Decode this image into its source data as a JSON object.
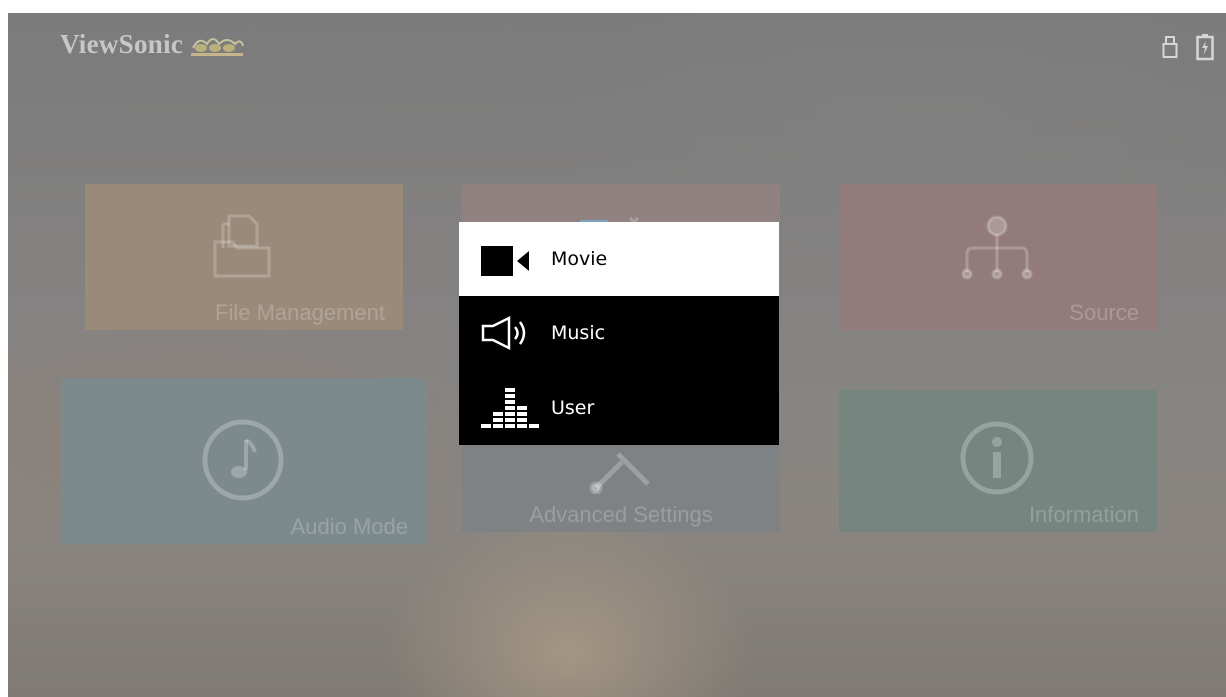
{
  "brand": {
    "name": "ViewSonic"
  },
  "status": {
    "icons": [
      "usb-icon",
      "battery-icon"
    ]
  },
  "tiles": [
    {
      "label": "File Management",
      "icon": "folder-icon"
    },
    {
      "label": "",
      "icon": "display-icon"
    },
    {
      "label": "Source",
      "icon": "source-icon"
    },
    {
      "label": "Audio Mode",
      "icon": "music-note-icon"
    },
    {
      "label": "Advanced Settings",
      "icon": "tools-icon"
    },
    {
      "label": "Information",
      "icon": "info-icon"
    }
  ],
  "audio_mode_menu": {
    "selected": "Movie",
    "items": [
      {
        "label": "Movie",
        "icon": "camera-icon"
      },
      {
        "label": "Music",
        "icon": "speaker-icon"
      },
      {
        "label": "User",
        "icon": "equalizer-icon"
      }
    ]
  },
  "colors": {
    "popup_bg": "#000000",
    "popup_selected_bg": "#ffffff",
    "tile_label": "rgba(255,255,255,0.22)"
  }
}
